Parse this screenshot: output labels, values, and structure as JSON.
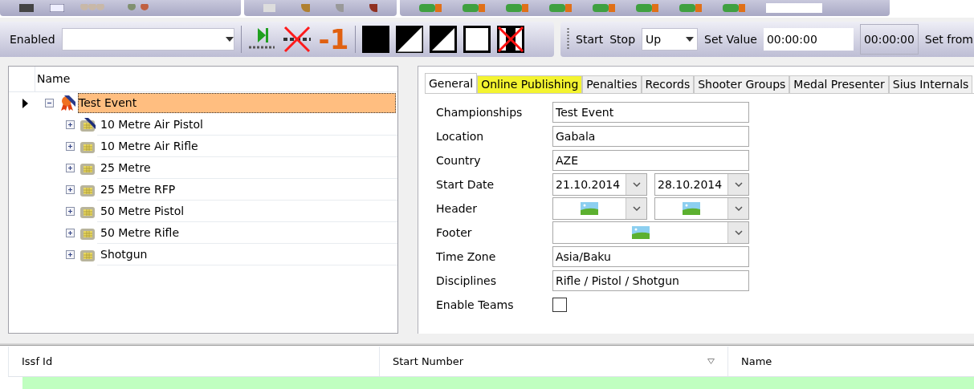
{
  "toolbar_left": {
    "filter_label": "Enabled",
    "minus_label": "-1"
  },
  "toolbar_right": {
    "start": "Start",
    "stop": "Stop",
    "direction": "Up",
    "set_value_label": "Set Value",
    "set_value": "00:00:00",
    "clock": "00:00:00",
    "set_from": "Set from"
  },
  "tree": {
    "column": "Name",
    "items": [
      {
        "label": "Test Event",
        "kind": "championship",
        "selected": true,
        "expanded": true,
        "current": true,
        "children": [
          {
            "label": "10 Metre Air Pistol",
            "kind": "marked",
            "selected": false,
            "expanded": false
          },
          {
            "label": "10 Metre Air Rifle",
            "kind": "discipline",
            "selected": false,
            "expanded": false
          },
          {
            "label": "25 Metre",
            "kind": "discipline",
            "selected": false,
            "expanded": false
          },
          {
            "label": "25 Metre RFP",
            "kind": "discipline",
            "selected": false,
            "expanded": false
          },
          {
            "label": "50 Metre Pistol",
            "kind": "discipline",
            "selected": false,
            "expanded": false
          },
          {
            "label": "50 Metre Rifle",
            "kind": "discipline",
            "selected": false,
            "expanded": false
          },
          {
            "label": "Shotgun",
            "kind": "discipline",
            "selected": false,
            "expanded": false
          }
        ]
      }
    ]
  },
  "tabs": [
    {
      "label": "General",
      "selected": true,
      "highlighted": false
    },
    {
      "label": "Online Publishing",
      "selected": false,
      "highlighted": true
    },
    {
      "label": "Penalties",
      "selected": false,
      "highlighted": false
    },
    {
      "label": "Records",
      "selected": false,
      "highlighted": false
    },
    {
      "label": "Shooter Groups",
      "selected": false,
      "highlighted": false
    },
    {
      "label": "Medal Presenter",
      "selected": false,
      "highlighted": false
    },
    {
      "label": "Sius Internals",
      "selected": false,
      "highlighted": false
    }
  ],
  "form": [
    {
      "label": "Championships",
      "kind": "text",
      "value": "Test Event"
    },
    {
      "label": "Location",
      "kind": "text",
      "value": "Gabala"
    },
    {
      "label": "Country",
      "kind": "text",
      "value": "AZE"
    },
    {
      "label": "Start Date",
      "kind": "date-pair",
      "values": [
        "21.10.2014",
        "28.10.2014"
      ]
    },
    {
      "label": "Header",
      "kind": "image-pair"
    },
    {
      "label": "Footer",
      "kind": "image"
    },
    {
      "label": "Time Zone",
      "kind": "text",
      "value": "Asia/Baku"
    },
    {
      "label": "Disciplines",
      "kind": "text",
      "value": "Rifle / Pistol / Shotgun"
    },
    {
      "label": "Enable Teams",
      "kind": "checkbox",
      "checked": false
    }
  ],
  "grid": {
    "columns": [
      {
        "label": "Issf Id",
        "sorted": false
      },
      {
        "label": "Start Number",
        "sorted": true
      },
      {
        "label": "Name",
        "sorted": false
      }
    ]
  }
}
